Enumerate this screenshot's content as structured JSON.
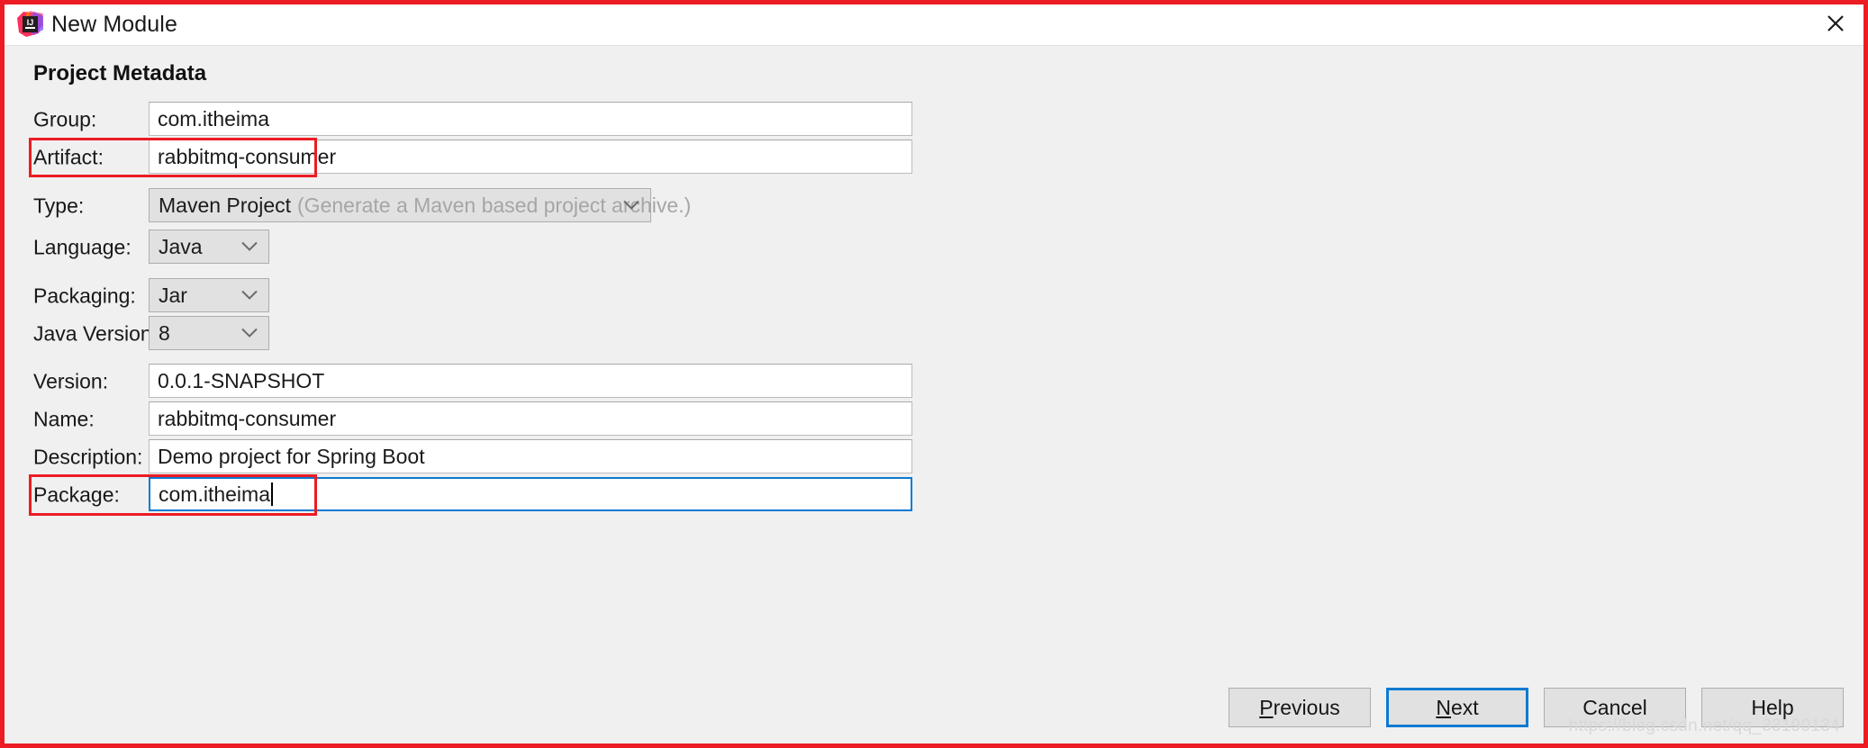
{
  "window": {
    "title": "New Module",
    "app_icon": "intellij-idea-icon",
    "close_icon": "close-icon",
    "border_color": "#ec1c24",
    "annotation_color": "#ec1c24",
    "focus_color": "#0b7ad1"
  },
  "section": {
    "heading": "Project Metadata"
  },
  "fields": {
    "group": {
      "label": "Group:",
      "value": "com.itheima"
    },
    "artifact": {
      "label": "Artifact:",
      "value": "rabbitmq-consumer"
    },
    "type": {
      "label": "Type:",
      "value": "Maven Project",
      "hint": "(Generate a Maven based project archive.)",
      "chevron_icon": "chevron-down-icon"
    },
    "language": {
      "label": "Language:",
      "value": "Java",
      "chevron_icon": "chevron-down-icon"
    },
    "packaging": {
      "label": "Packaging:",
      "value": "Jar",
      "chevron_icon": "chevron-down-icon"
    },
    "java_version": {
      "label": "Java Version:",
      "value": "8",
      "chevron_icon": "chevron-down-icon"
    },
    "version": {
      "label": "Version:",
      "value": "0.0.1-SNAPSHOT"
    },
    "name": {
      "label": "Name:",
      "value": "rabbitmq-consumer"
    },
    "description": {
      "label": "Description:",
      "value": "Demo project for Spring Boot"
    },
    "package": {
      "label": "Package:",
      "value": "com.itheima"
    }
  },
  "buttons": {
    "previous": {
      "prefix": "",
      "mnemonic": "P",
      "suffix": "revious"
    },
    "next": {
      "prefix": "",
      "mnemonic": "N",
      "suffix": "ext"
    },
    "cancel": {
      "label": "Cancel"
    },
    "help": {
      "label": "Help"
    }
  },
  "watermark": {
    "text": "https://blog.csdn.net/qq_33190134"
  }
}
